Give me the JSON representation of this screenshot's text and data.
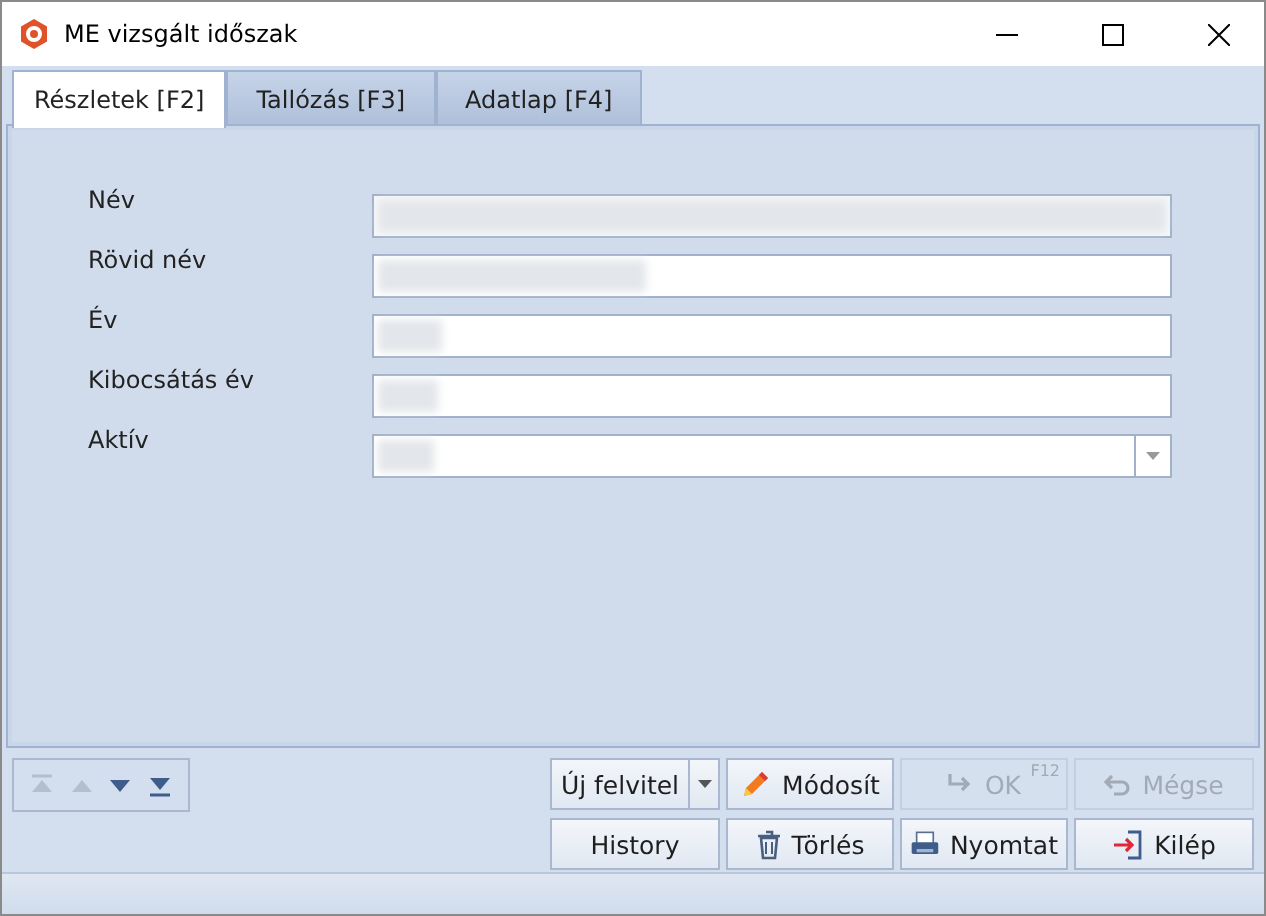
{
  "window": {
    "title": "ME vizsgált időszak"
  },
  "tabs": [
    {
      "label": "Részletek [F2]",
      "selected": true
    },
    {
      "label": "Tallózás [F3]",
      "selected": false
    },
    {
      "label": "Adatlap [F4]",
      "selected": false
    }
  ],
  "fields": [
    {
      "label": "Név",
      "kind": "text"
    },
    {
      "label": "Rövid név",
      "kind": "text"
    },
    {
      "label": "Év",
      "kind": "text"
    },
    {
      "label": "Kibocsátás év",
      "kind": "text"
    },
    {
      "label": "Aktív",
      "kind": "dropdown"
    }
  ],
  "navigation": [
    {
      "kind": "first",
      "disabled": true
    },
    {
      "kind": "previous",
      "disabled": true
    },
    {
      "kind": "next",
      "disabled": false
    },
    {
      "kind": "last",
      "disabled": false
    }
  ],
  "buttons": [
    {
      "label": "Új felvitel",
      "kind": "new",
      "split": true,
      "disabled": false
    },
    {
      "label": "Módosít",
      "kind": "edit",
      "disabled": false
    },
    {
      "label": "OK",
      "kind": "ok",
      "shortcut": "F12",
      "disabled": true
    },
    {
      "label": "Mégse",
      "kind": "cancel",
      "disabled": true
    },
    {
      "label": "History",
      "kind": "history",
      "disabled": false
    },
    {
      "label": "Törlés",
      "kind": "delete",
      "disabled": false
    },
    {
      "label": "Nyomtat",
      "kind": "print",
      "disabled": false
    },
    {
      "label": "Kilép",
      "kind": "exit",
      "disabled": false
    }
  ]
}
